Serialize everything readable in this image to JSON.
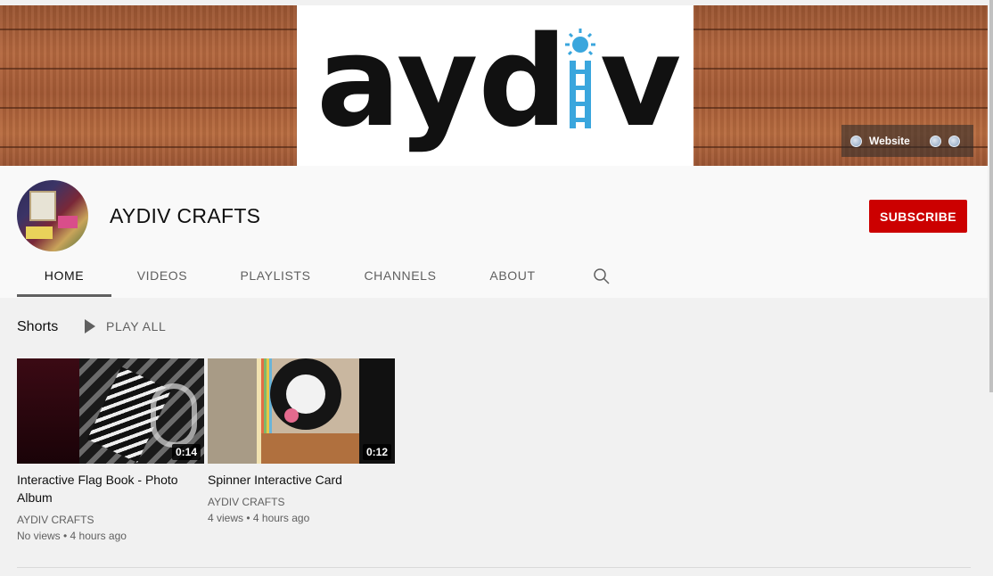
{
  "banner": {
    "logo_text": "aydiv",
    "links": {
      "website_label": "Website"
    }
  },
  "channel": {
    "name": "AYDIV CRAFTS",
    "subscribe_label": "SUBSCRIBE"
  },
  "tabs": [
    {
      "label": "HOME",
      "active": true
    },
    {
      "label": "VIDEOS"
    },
    {
      "label": "PLAYLISTS"
    },
    {
      "label": "CHANNELS"
    },
    {
      "label": "ABOUT"
    }
  ],
  "shorts": {
    "title": "Shorts",
    "play_all_label": "PLAY ALL",
    "videos": [
      {
        "title": "Interactive Flag Book - Photo Album",
        "duration": "0:14",
        "channel": "AYDIV CRAFTS",
        "stats": "No views • 4 hours ago"
      },
      {
        "title": "Spinner Interactive Card",
        "duration": "0:12",
        "channel": "AYDIV CRAFTS",
        "stats": "4 views • 4 hours ago"
      }
    ]
  },
  "colors": {
    "subscribe": "#cc0000",
    "logo_black": "#111111",
    "logo_blue": "#3aa6dd",
    "wood": "#a45a35"
  }
}
